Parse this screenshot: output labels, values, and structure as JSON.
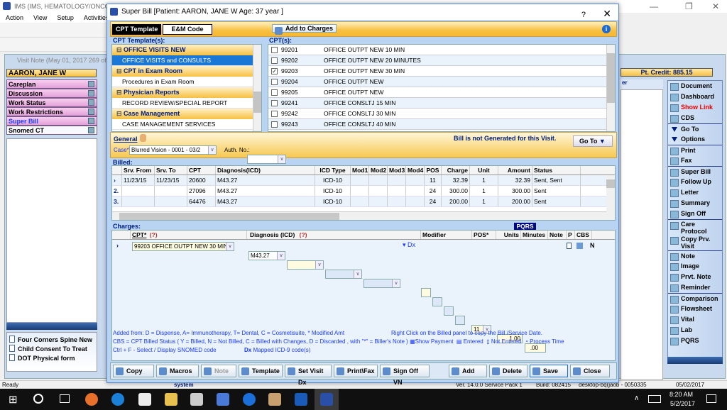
{
  "app": {
    "title": "IMS (IMS, HEMATOLOGY/ONCOL",
    "menu": [
      "Action",
      "View",
      "Setup",
      "Activities"
    ]
  },
  "visit_note": {
    "title": "Visit Note (May 01, 2017  269 of",
    "patient": "AARON, JANE W",
    "pt_credit": "Pt. Credit: 885.15",
    "right_header": "er"
  },
  "left_panel": {
    "items": [
      {
        "label": "Careplan"
      },
      {
        "label": "Discussion"
      },
      {
        "label": "Work Status"
      },
      {
        "label": "Work Restrictions"
      },
      {
        "label": "Super Bill",
        "selected": true
      },
      {
        "label": "Snomed CT"
      }
    ],
    "forms": [
      "Four Corners Spine New",
      "Child Consent To Treat",
      "DOT Physical form"
    ]
  },
  "right_panel": {
    "groups": [
      [
        {
          "label": "Document",
          "icon": "document-icon"
        },
        {
          "label": "Dashboard",
          "icon": "dashboard-icon"
        },
        {
          "label": "Show Link",
          "icon": "link-icon",
          "color": "#e00000"
        },
        {
          "label": "CDS",
          "icon": "cds-icon"
        }
      ],
      [
        {
          "label": "Go To",
          "icon": "triangle-down-icon"
        },
        {
          "label": "Options",
          "icon": "triangle-down-icon"
        }
      ],
      [
        {
          "label": "Print",
          "icon": "print-icon"
        },
        {
          "label": "Fax",
          "icon": "fax-icon"
        }
      ],
      [
        {
          "label": "Super Bill",
          "icon": "super-bill-icon"
        },
        {
          "label": "Follow Up",
          "icon": "calendar-icon"
        },
        {
          "label": "Letter",
          "icon": "letter-icon"
        },
        {
          "label": "Summary",
          "icon": "summary-icon"
        },
        {
          "label": "Sign Off",
          "icon": "sign-off-icon"
        }
      ],
      [
        {
          "label": "Care Protocol",
          "icon": "protocol-icon"
        },
        {
          "label": "Copy Prv. Visit",
          "icon": "copy-icon"
        }
      ],
      [
        {
          "label": "Note",
          "icon": "note-icon"
        },
        {
          "label": "Image",
          "icon": "image-icon"
        },
        {
          "label": "Prvt. Note",
          "icon": "private-note-icon"
        },
        {
          "label": "Reminder",
          "icon": "reminder-icon"
        }
      ],
      [
        {
          "label": "Comparison",
          "icon": "chart-icon"
        },
        {
          "label": "Flowsheet",
          "icon": "chart-icon"
        },
        {
          "label": "Vital",
          "icon": "chart-icon"
        },
        {
          "label": "Lab",
          "icon": "chart-icon"
        },
        {
          "label": "PQRS",
          "icon": "chart-icon"
        }
      ]
    ]
  },
  "dialog": {
    "title": "Super Bill  [Patient: AARON, JANE W  Age: 37 year ]",
    "help": "?",
    "close": "✕",
    "tabs": {
      "cpt_template": "CPT Template",
      "em_code": "E&M Code"
    },
    "add_to_charges": "Add to Charges",
    "info": "i",
    "templates_label": "CPT Template(s):",
    "templates": [
      {
        "group": "OFFICE VISITS NEW",
        "items": [
          {
            "label": "OFFICE VISITS and CONSULTS",
            "selected": true
          }
        ]
      },
      {
        "group": "CPT in Exam Room",
        "items": [
          {
            "label": "Procedures in Exam Room"
          }
        ]
      },
      {
        "group": "Physician Reports",
        "items": [
          {
            "label": "RECORD REVIEW/SPECIAL REPORT"
          }
        ]
      },
      {
        "group": "Case Management",
        "items": [
          {
            "label": "CASE MANAGEMENT SERVICES"
          }
        ]
      }
    ],
    "cpts_label": "CPT(s):",
    "cpts": [
      {
        "code": "99201",
        "desc": "OFFICE OUTPT NEW 10 MIN",
        "checked": false
      },
      {
        "code": "99202",
        "desc": "OFFICE OUTPT NEW 20 MINUTES",
        "checked": false
      },
      {
        "code": "99203",
        "desc": "OFFICE OUTPT NEW 30 MIN",
        "checked": true
      },
      {
        "code": "99204",
        "desc": "OFFICE OUTPT NEW",
        "checked": false
      },
      {
        "code": "99205",
        "desc": "OFFICE OUTPT NEW",
        "checked": false
      },
      {
        "code": "99241",
        "desc": "OFFICE CONSLTJ 15 MIN",
        "checked": false
      },
      {
        "code": "99242",
        "desc": "OFFICE CONSLTJ 30 MIN",
        "checked": false
      },
      {
        "code": "99243",
        "desc": "OFFICE CONSLTJ 40 MIN",
        "checked": false
      }
    ],
    "general": {
      "label": "General",
      "case_label": "Case*",
      "case_value": "Blurred Vision  -  0001 - 03/2",
      "auth_label": "Auth. No.:",
      "auth_value": "",
      "bill_status": "Bill is not Generated for this Visit.",
      "goto": "Go To"
    },
    "billed": {
      "label": "Billed:",
      "columns": [
        "",
        "Srv. From",
        "Srv. To",
        "CPT",
        "Diagnosis(ICD)",
        "ICD Type",
        "Mod1",
        "Mod2",
        "Mod3",
        "Mod4",
        "POS",
        "Charge",
        "Unit",
        "Amount",
        "Status"
      ],
      "rows": [
        [
          "›",
          "11/23/15",
          "11/23/15",
          "20600",
          "M43.27",
          "ICD-10",
          "",
          "",
          "",
          "",
          "11",
          "32.39",
          "1",
          "32.39",
          "Sent, Sent"
        ],
        [
          "2.",
          "",
          "",
          "27096",
          "M43.27",
          "ICD-10",
          "",
          "",
          "",
          "",
          "24",
          "300.00",
          "1",
          "300.00",
          "Sent"
        ],
        [
          "3.",
          "",
          "",
          "64476",
          "M43.27",
          "ICD-10",
          "",
          "",
          "",
          "",
          "24",
          "200.00",
          "1",
          "200.00",
          "Sent"
        ]
      ]
    },
    "charges": {
      "label": "Charges:",
      "pqrs": "PQRS",
      "columns": {
        "cpt": "CPT*",
        "help": "(?)",
        "diagnosis": "Diagnosis (ICD)",
        "modifier": "Modifier",
        "pos": "POS*",
        "units": "Units",
        "minutes": "Minutes",
        "note": "Note",
        "p": "P",
        "cbs": "CBS"
      },
      "row": {
        "marker": "›",
        "cpt": "99203     OFFICE OUTPT NEW 30 MIN",
        "icd": "M43.27",
        "dx": "Dx",
        "pos": "11",
        "units": "1.00",
        "minutes": ".00",
        "cbs": "N"
      }
    },
    "legend": {
      "line1": "Added from: D = Dispense, A= Immunotherapy, T= Dental,  C = Cosmetisuite,   * Modified Amt",
      "line1_right": "Right Click on the Billed panel to copy the Bill /Service Date.",
      "line2": "CBS = CPT Billed Status ( Y = Billed, N = Not Billed, C = Billed with Changes, D = Discarded , with \"*\" = Biller's Note )",
      "show_payment": "Show Payment",
      "entered": "Entered",
      "not_entered": "Not Entered",
      "process_time": "Process Time",
      "line3": "Ctrl + F - Select / Display SNOMED code",
      "dx": "Dx",
      "mapped": "Mapped ICD-9 code(s)"
    },
    "buttons": {
      "copy": "Copy",
      "macros": "Macros",
      "note": "Note",
      "template": "Template",
      "set_visit_dx": "Set Visit Dx",
      "print_fax": "Print\\Fax",
      "sign_off_vn": "Sign Off VN",
      "add": "Add",
      "delete": "Delete",
      "save": "Save",
      "close": "Close"
    }
  },
  "status_bar": {
    "ready": "Ready",
    "user": "system",
    "version": "Ver. 14.0.0 Service Pack 1",
    "build": "Build: 082415",
    "machine": "desktop-bq(jaob - 0050335",
    "date": "05/02/2017"
  },
  "taskbar": {
    "time": "8:20 AM",
    "date": "5/2/2017"
  },
  "colors": {
    "accent_orange": "#f7c040",
    "dialog_blue": "#b9d3f2",
    "selection": "#1b77d6",
    "label_navy": "#002080"
  }
}
